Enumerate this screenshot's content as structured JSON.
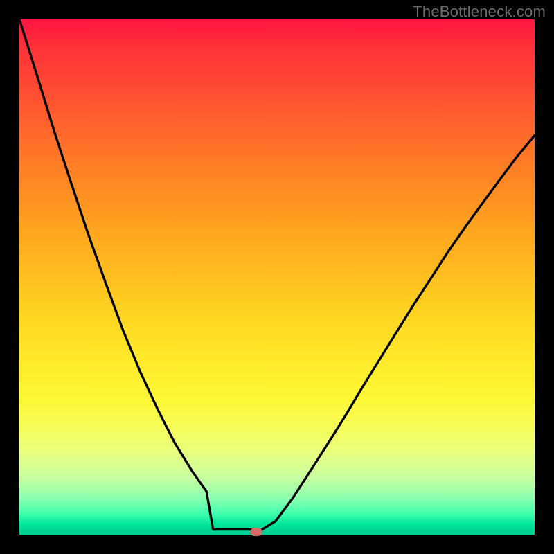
{
  "watermark": "TheBottleneck.com",
  "colors": {
    "page_bg": "#000000",
    "curve_stroke": "#000000",
    "marker_fill": "#d96a66",
    "gradient_top": "#ff1540",
    "gradient_bottom": "#00c98f"
  },
  "chart_data": {
    "type": "line",
    "title": "",
    "xlabel": "",
    "ylabel": "",
    "xlim": [
      0,
      1
    ],
    "ylim": [
      0,
      1
    ],
    "note": "Axes are unlabeled; values are normalized to [0,1] both axes. y measured from top (0=top, 1=bottom).",
    "series": [
      {
        "name": "curve",
        "x": [
          0.0,
          0.034,
          0.067,
          0.101,
          0.134,
          0.168,
          0.201,
          0.235,
          0.269,
          0.302,
          0.336,
          0.363,
          0.383,
          0.403,
          0.423,
          0.443,
          0.463,
          0.497,
          0.53,
          0.563,
          0.597,
          0.631,
          0.664,
          0.698,
          0.732,
          0.765,
          0.799,
          0.832,
          0.866,
          0.9,
          0.933,
          0.966,
          1.0
        ],
        "y": [
          0.0,
          0.108,
          0.215,
          0.319,
          0.418,
          0.513,
          0.603,
          0.685,
          0.758,
          0.823,
          0.878,
          0.916,
          0.94,
          0.96,
          0.976,
          0.987,
          0.995,
          0.974,
          0.93,
          0.879,
          0.826,
          0.772,
          0.717,
          0.662,
          0.607,
          0.554,
          0.502,
          0.451,
          0.402,
          0.355,
          0.31,
          0.266,
          0.225
        ]
      },
      {
        "name": "flat-bottom",
        "x": [
          0.376,
          0.46
        ],
        "y": [
          0.99,
          0.99
        ]
      }
    ],
    "marker": {
      "x": 0.46,
      "y": 0.994
    }
  }
}
